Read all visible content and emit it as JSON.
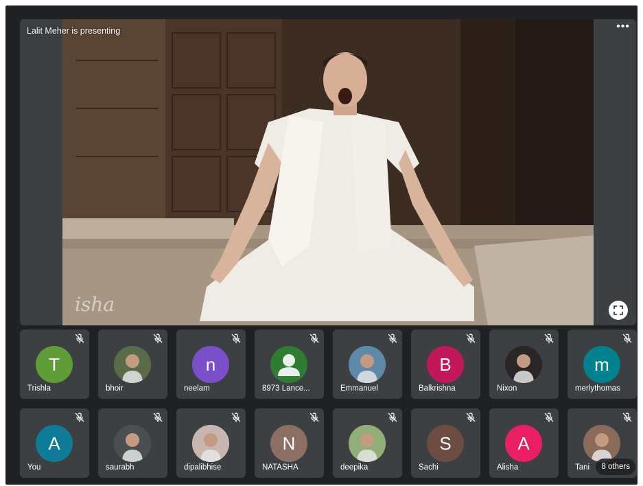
{
  "stage": {
    "presenter_label": "Lalit Meher is presenting",
    "more_label": "•••",
    "watermark": "isha"
  },
  "participants": [
    {
      "name": "Trishla",
      "initial": "T",
      "color": "#5f9e37",
      "type": "initial"
    },
    {
      "name": "bhoir",
      "initial": "",
      "color": "#5a6b4a",
      "type": "photo"
    },
    {
      "name": "neelam",
      "initial": "n",
      "color": "#7b4fc9",
      "type": "initial"
    },
    {
      "name": "8973 Lance...",
      "initial": "",
      "color": "#2e7d32",
      "type": "default"
    },
    {
      "name": "Emmanuel",
      "initial": "",
      "color": "#5c8aa8",
      "type": "photo"
    },
    {
      "name": "Balkrishna",
      "initial": "B",
      "color": "#c2185b",
      "type": "initial"
    },
    {
      "name": "Nixon",
      "initial": "",
      "color": "#2a2626",
      "type": "photo"
    },
    {
      "name": "merlythomas",
      "initial": "m",
      "color": "#00838f",
      "type": "initial"
    },
    {
      "name": "You",
      "initial": "A",
      "color": "#0e7c99",
      "type": "initial"
    },
    {
      "name": "saurabh",
      "initial": "",
      "color": "#4a4f52",
      "type": "photo"
    },
    {
      "name": "dipalibhise",
      "initial": "",
      "color": "#c7b7b0",
      "type": "photo"
    },
    {
      "name": "NATASHA",
      "initial": "N",
      "color": "#8d6e63",
      "type": "initial"
    },
    {
      "name": "deepika",
      "initial": "",
      "color": "#8fae78",
      "type": "photo"
    },
    {
      "name": "Sachi",
      "initial": "S",
      "color": "#6d4c41",
      "type": "initial"
    },
    {
      "name": "Alisha",
      "initial": "A",
      "color": "#e91e63",
      "type": "initial"
    },
    {
      "name": "Tani",
      "initial": "",
      "color": "#8a6a58",
      "type": "photo"
    }
  ],
  "others_label": "8 others",
  "icons": {
    "mute": "mic-off-icon",
    "fullscreen": "fullscreen-icon",
    "more": "more-options-icon",
    "default_avatar": "person-icon"
  }
}
